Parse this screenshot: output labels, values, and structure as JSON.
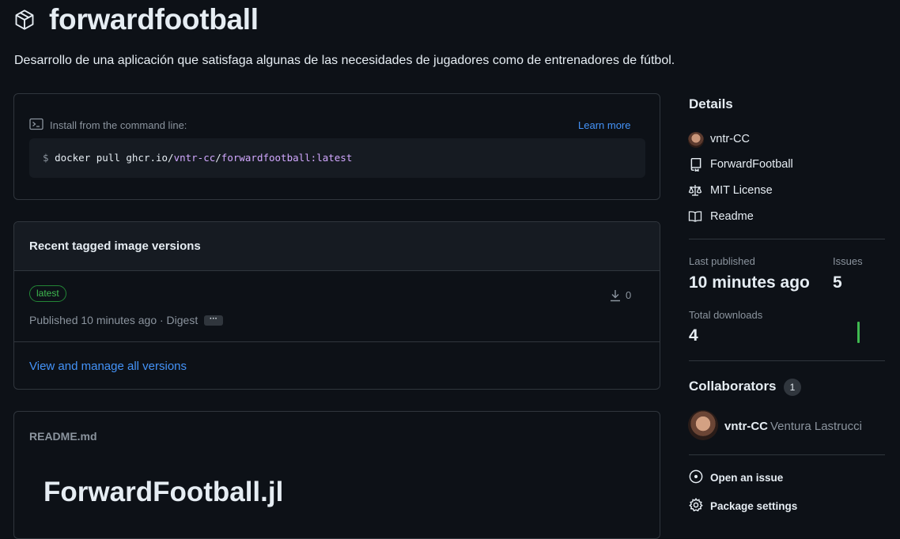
{
  "header": {
    "title": "forwardfootball",
    "description": "Desarrollo de una aplicación que satisfaga algunas de las necesidades de jugadores como de entrenadores de fútbol."
  },
  "install": {
    "label": "Install from the command line:",
    "learn_more": "Learn more",
    "cmd_prefix": "$ ",
    "cmd_plain1": "docker pull ghcr.io/",
    "cmd_owner": "vntr-cc",
    "cmd_slash": "/",
    "cmd_image": "forwardfootball:latest"
  },
  "versions": {
    "heading": "Recent tagged image versions",
    "tag": "latest",
    "downloads": "0",
    "published": "Published 10 minutes ago · Digest",
    "digest_button": "···",
    "view_all": "View and manage all versions"
  },
  "readme": {
    "filename": "README.md",
    "heading": "ForwardFootball.jl"
  },
  "sidebar": {
    "details_heading": "Details",
    "owner": "vntr-CC",
    "repo": "ForwardFootball",
    "license": "MIT License",
    "readme": "Readme",
    "last_published_label": "Last published",
    "last_published_value": "10 minutes ago",
    "issues_label": "Issues",
    "issues_value": "5",
    "downloads_label": "Total downloads",
    "downloads_value": "4",
    "collaborators_heading": "Collaborators",
    "collaborators_count": "1",
    "collab_login": "vntr-CC",
    "collab_name": "Ventura Lastrucci",
    "open_issue": "Open an issue",
    "package_settings": "Package settings"
  },
  "colors": {
    "background": "#0d1117",
    "border": "#30363d",
    "link": "#4493f8",
    "success": "#3fb950",
    "muted": "#8b949e"
  }
}
